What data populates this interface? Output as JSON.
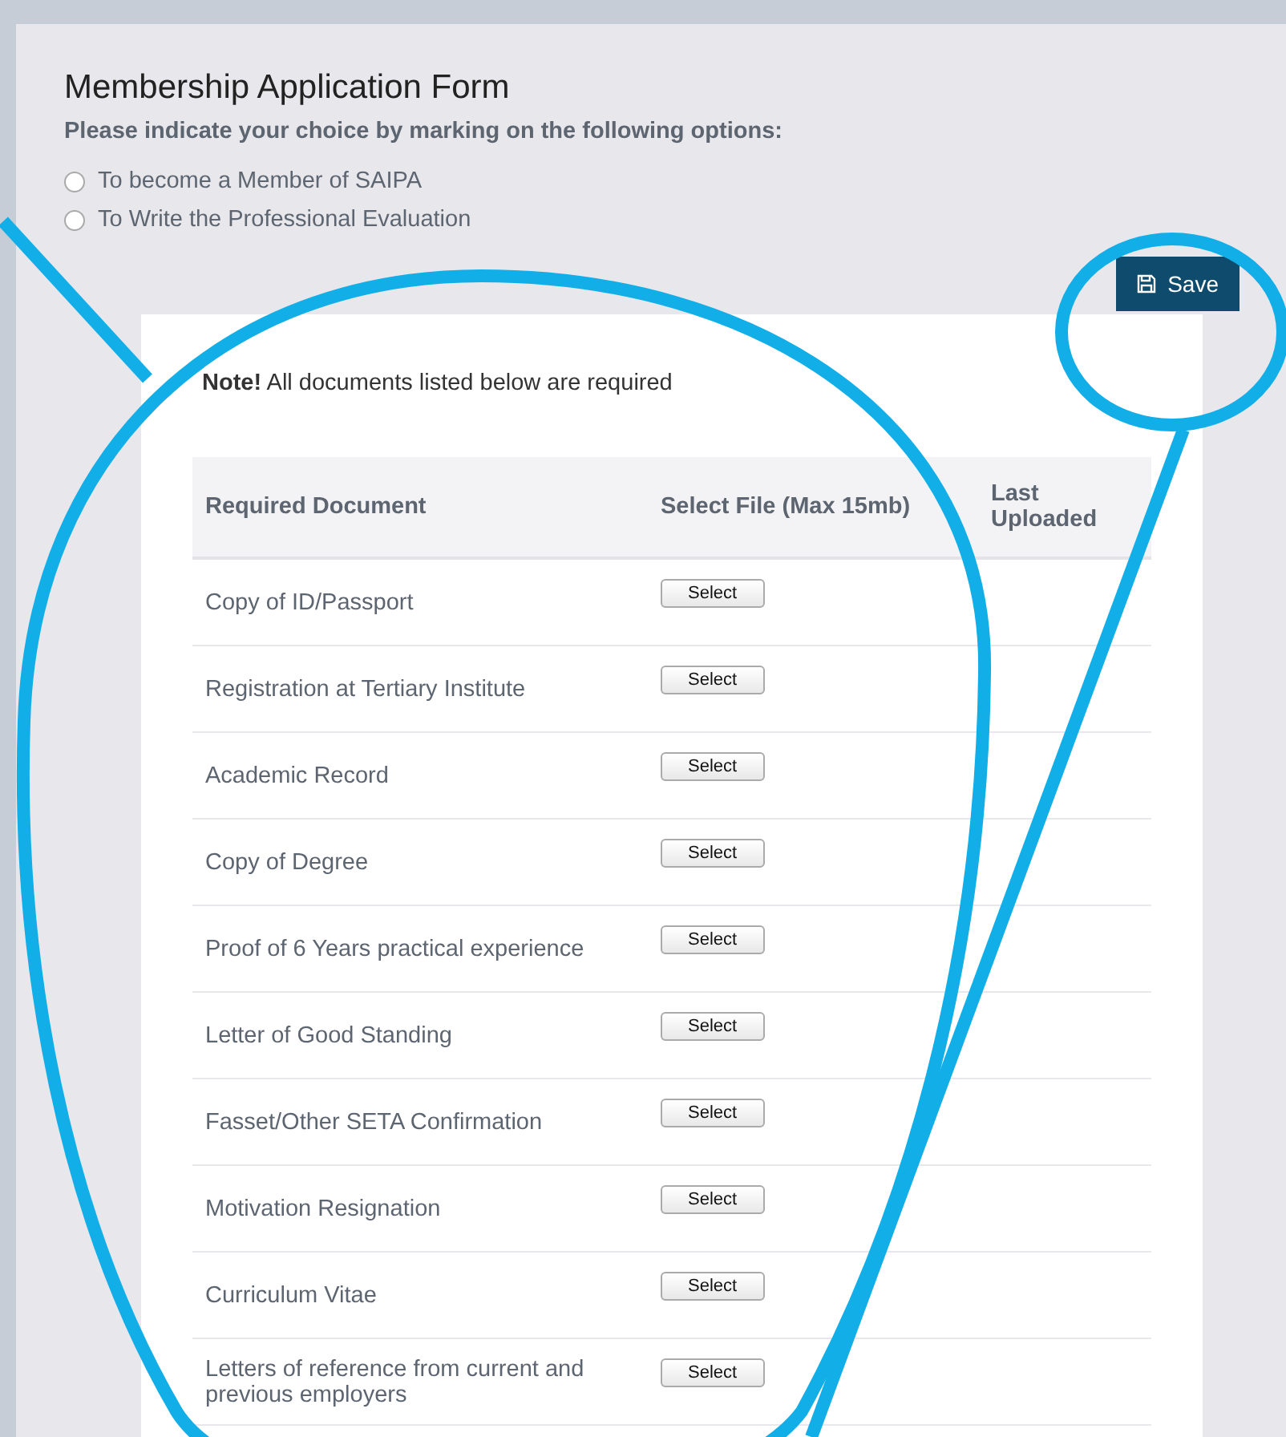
{
  "form": {
    "title": "Membership Application Form",
    "instruction": "Please indicate your choice by marking on the following options:",
    "options": [
      {
        "label": "To become a Member of SAIPA",
        "selected": false
      },
      {
        "label": "To Write the Professional Evaluation",
        "selected": false
      }
    ],
    "save_button": "Save"
  },
  "note": "**Note!** All documents listed below are required",
  "table": {
    "columns": [
      "Required Document",
      "Select File (Max 15mb)",
      "Last Uploaded"
    ],
    "rows": [
      {
        "document": "Copy of ID/Passport",
        "button": "Select"
      },
      {
        "document": "Registration at Tertiary Institute",
        "button": "Select"
      },
      {
        "document": "Academic Record",
        "button": "Select"
      },
      {
        "document": "Copy of Degree",
        "button": "Select"
      },
      {
        "document": "Proof of 6 Years practical experience",
        "button": "Select"
      },
      {
        "document": "Letter of Good Standing",
        "button": "Select"
      },
      {
        "document": "Fasset/Other SETA Confirmation",
        "button": "Select"
      },
      {
        "document": "Motivation Resignation",
        "button": "Select"
      },
      {
        "document": "Curriculum Vitae",
        "button": "Select"
      },
      {
        "document": "Letters of reference from current and previous employers",
        "button": "Select"
      }
    ]
  }
}
